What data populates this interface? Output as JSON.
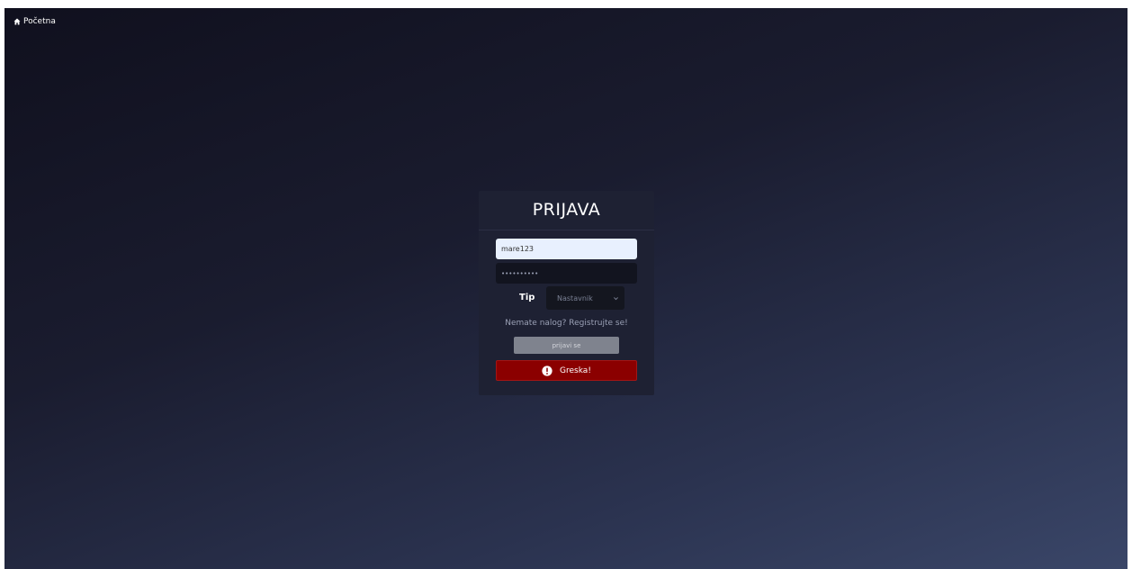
{
  "nav": {
    "home_label": "Početna",
    "home_icon": "home-icon"
  },
  "login": {
    "title": "PRIJAVA",
    "username_value": "mare123",
    "password_value": "••••••••••",
    "type_label": "Tip",
    "type_selected": "Nastavnik",
    "register_text": "Nemate nalog? Registrujte se!",
    "submit_label": "prijavi se",
    "error_text": "Greska!",
    "error_icon": "exclamation-circle-icon"
  },
  "colors": {
    "error_bg": "#8b0000",
    "card_bg": "#1e2133",
    "button_bg": "#7f838e"
  }
}
